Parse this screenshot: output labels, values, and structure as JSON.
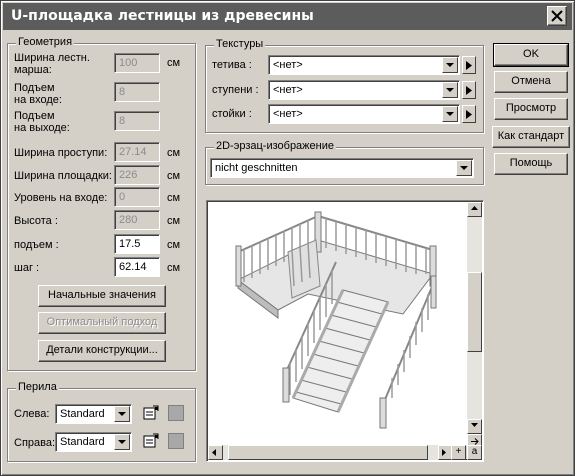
{
  "window": {
    "title": "U-площадка лестницы из древесины"
  },
  "geometry": {
    "legend": "Геометрия",
    "unit": "см",
    "rows": [
      {
        "label": "Ширина лестн. марша:",
        "value": "100",
        "unit": "см"
      },
      {
        "label": "Подъем на входе:",
        "value": "8",
        "unit": ""
      },
      {
        "label": "Подъем на выходе:",
        "value": "8",
        "unit": ""
      },
      {
        "label": "Ширина проступи:",
        "value": "27.14",
        "unit": "см"
      },
      {
        "label": "Ширина площадки:",
        "value": "226",
        "unit": "см"
      },
      {
        "label": "Уровень на входе:",
        "value": "0",
        "unit": "см"
      },
      {
        "label": "Высота :",
        "value": "280",
        "unit": "см"
      },
      {
        "label": "подъем :",
        "value": "17.5",
        "unit": "см"
      },
      {
        "label": "шаг :",
        "value": "62.14",
        "unit": "см"
      }
    ],
    "label_lines": {
      "width_1": "Ширина лестн.",
      "width_2": "марша:",
      "rise_in_1": "Подъем",
      "rise_in_2": "на входе:",
      "rise_out_1": "Подъем",
      "rise_out_2": "на выходе:"
    },
    "buttons": {
      "initial": "Начальные значения",
      "optimal": "Оптимальный подход",
      "details": "Детали конструкции..."
    }
  },
  "railing": {
    "legend": "Перила",
    "left_label": "Слева:",
    "left_value": "Standard",
    "right_label": "Справа:",
    "right_value": "Standard"
  },
  "textures": {
    "legend": "Текстуры",
    "stringer_label": "тетива :",
    "stringer_value": "<нет>",
    "steps_label": "ступени :",
    "steps_value": "<нет>",
    "posts_label": "стойки :",
    "posts_value": "<нет>"
  },
  "substitute": {
    "legend": "2D-эрзац-изображение",
    "value": "nicht geschnitten"
  },
  "actions": {
    "ok": "OK",
    "cancel": "Отмена",
    "preview": "Просмотр",
    "as_default": "Как стандарт",
    "help": "Помощь"
  },
  "preview_controls": {
    "plus": "+",
    "minus": "-",
    "a": "a"
  },
  "colors": {
    "titlebar": "#5c5c5c",
    "face": "#d4d0c8",
    "swatch": "#a8a8a8"
  },
  "icons": [
    "close-icon",
    "dropdown-arrow-icon",
    "play-arrow-icon",
    "properties-icon",
    "scroll-arrow-icon"
  ]
}
